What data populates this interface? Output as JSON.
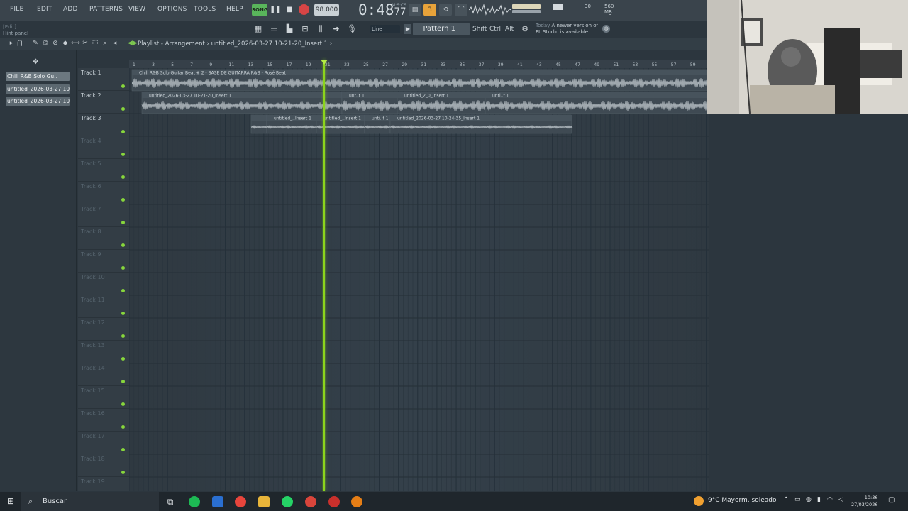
{
  "menu": [
    "FILE",
    "EDIT",
    "ADD",
    "PATTERNS",
    "VIEW",
    "OPTIONS",
    "TOOLS",
    "HELP"
  ],
  "hint_panel": {
    "small": "[Edit]",
    "label": "Hint panel"
  },
  "transport": {
    "mode": "SONG",
    "pause": "❚❚",
    "stop": "■",
    "tempo": "98.000",
    "time": "0:48",
    "time_sub": "77",
    "time_unit": "M:S:CS"
  },
  "monitor": {
    "cpu": "30",
    "ram": "560 MB",
    "polyphony": "3"
  },
  "toolbar2": {
    "snap": "Line",
    "pattern": "Pattern 1",
    "shift": "Shift",
    "ctrl": "Ctrl",
    "alt": "Alt"
  },
  "news": {
    "today": "Today",
    "text": "A newer version of FL Studio is available!"
  },
  "playlist": {
    "title": "Playlist - Arrangement",
    "separator": "›",
    "current": "untitled_2026-03-27 10-21-20_Insert 1",
    "end_arrow": "›"
  },
  "picker": [
    "Chill R&B Solo Gu..",
    "untitled_2026-03-27 10-...",
    "untitled_2026-03-27 10-..."
  ],
  "ruler_marks": [
    "1",
    "3",
    "5",
    "7",
    "9",
    "11",
    "13",
    "15",
    "17",
    "19",
    "21",
    "23",
    "25",
    "27",
    "29",
    "31",
    "33",
    "35",
    "37",
    "39",
    "41",
    "43",
    "45",
    "47",
    "49",
    "51",
    "53",
    "55",
    "57",
    "59"
  ],
  "tracks": [
    "Track 1",
    "Track 2",
    "Track 3",
    "Track 4",
    "Track 5",
    "Track 6",
    "Track 7",
    "Track 8",
    "Track 9",
    "Track 10",
    "Track 11",
    "Track 12",
    "Track 13",
    "Track 14",
    "Track 15",
    "Track 16",
    "Track 17",
    "Track 18",
    "Track 19"
  ],
  "clips": {
    "track1": "Chill R&B Solo Guitar Beat # 2 - BASE DE GUITARRA R&B - Rosé Beat",
    "track2": [
      "untitled_2026-03-27 10-21-20_Insert 1",
      "unt..t 1",
      "untitled_2_0_Insert 1",
      "unti..t 1"
    ],
    "track3": [
      "untitled_..Insert 1",
      "untitled_..Insert 1",
      "unti..t 1",
      "untitled_2026-03-27 10-24-35_Insert 1"
    ]
  },
  "taskbar": {
    "search": "Buscar",
    "weather": "9°C  Mayorm. soleado",
    "time": "10:36",
    "date": "27/03/2026"
  },
  "colors": {
    "accent_green": "#8bd41c",
    "record": "#d64545",
    "clip": "#5c6870",
    "background": "#2c363e"
  }
}
